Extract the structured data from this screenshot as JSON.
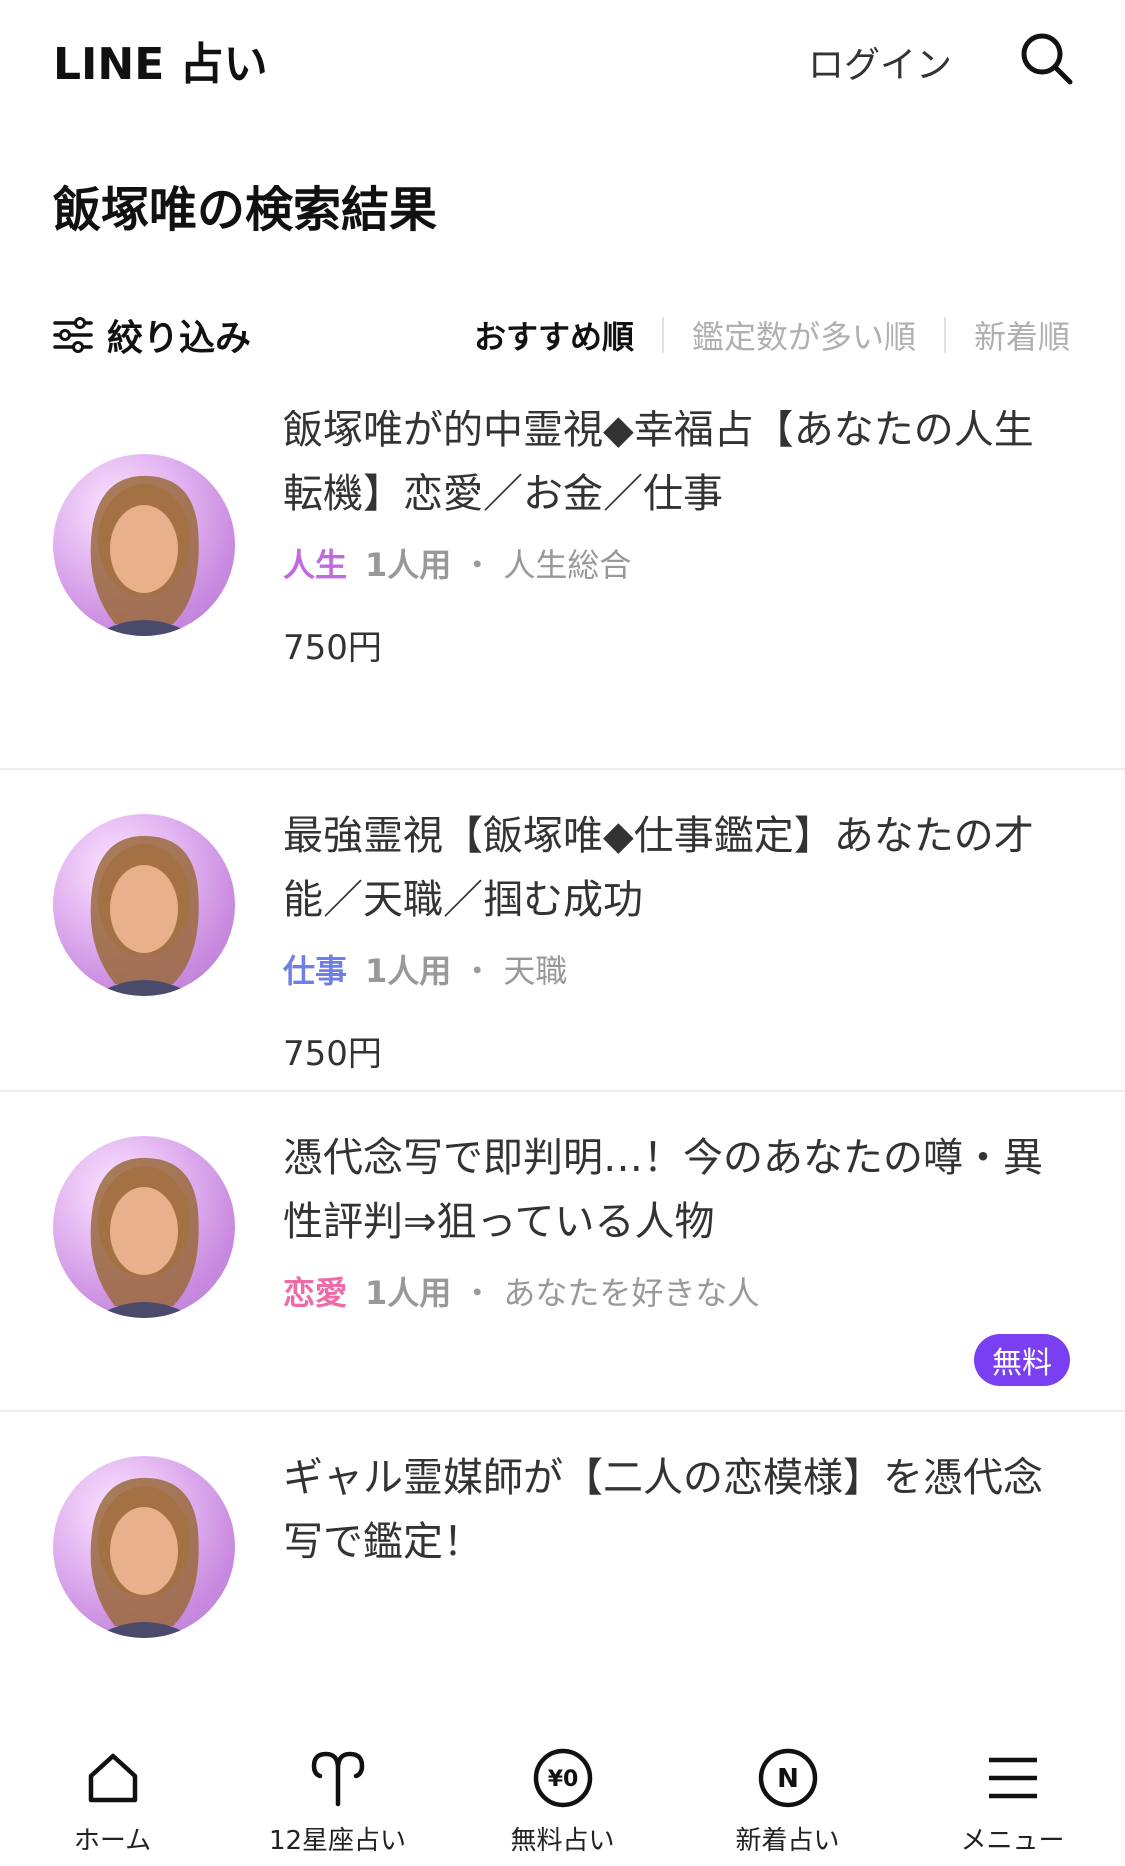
{
  "header": {
    "logo": "LINE 占い",
    "login_label": "ログイン"
  },
  "page": {
    "title": "飯塚唯の検索結果"
  },
  "filter": {
    "label": "絞り込み",
    "sort_tabs": [
      "おすすめ順",
      "鑑定数が多い順",
      "新着順"
    ],
    "active_tab": "おすすめ順"
  },
  "results": [
    {
      "title": "飯塚唯が的中霊視◆幸福占【あなたの人生転機】恋愛／お金／仕事",
      "category": "人生",
      "category_color": "#c06ae0",
      "people": "1人用",
      "sub_category": "人生総合",
      "price": "750円",
      "badge": ""
    },
    {
      "title": "最強霊視【飯塚唯◆仕事鑑定】あなたの才能／天職／掴む成功",
      "category": "仕事",
      "category_color": "#6f7fe6",
      "people": "1人用",
      "sub_category": "天職",
      "price": "750円",
      "badge": ""
    },
    {
      "title": "憑代念写で即判明…！今のあなたの噂・異性評判⇒狙っている人物",
      "category": "恋愛",
      "category_color": "#f06aa8",
      "people": "1人用",
      "sub_category": "あなたを好きな人",
      "price": "",
      "badge": "無料"
    },
    {
      "title": "ギャル霊媒師が【二人の恋模様】を憑代念写で鑑定！",
      "category": "",
      "category_color": "#f06aa8",
      "people": "",
      "sub_category": "",
      "price": "",
      "badge": ""
    }
  ],
  "bottom_nav": [
    {
      "label": "ホーム",
      "icon": "home-icon"
    },
    {
      "label": "12星座占い",
      "icon": "aries-icon"
    },
    {
      "label": "無料占い",
      "icon": "free-yen-icon"
    },
    {
      "label": "新着占い",
      "icon": "new-n-icon"
    },
    {
      "label": "メニュー",
      "icon": "menu-icon"
    }
  ],
  "colors": {
    "accent": "#7b3ff2",
    "cat_life": "#c06ae0",
    "cat_work": "#6f7fe6",
    "cat_love": "#f06aa8"
  }
}
